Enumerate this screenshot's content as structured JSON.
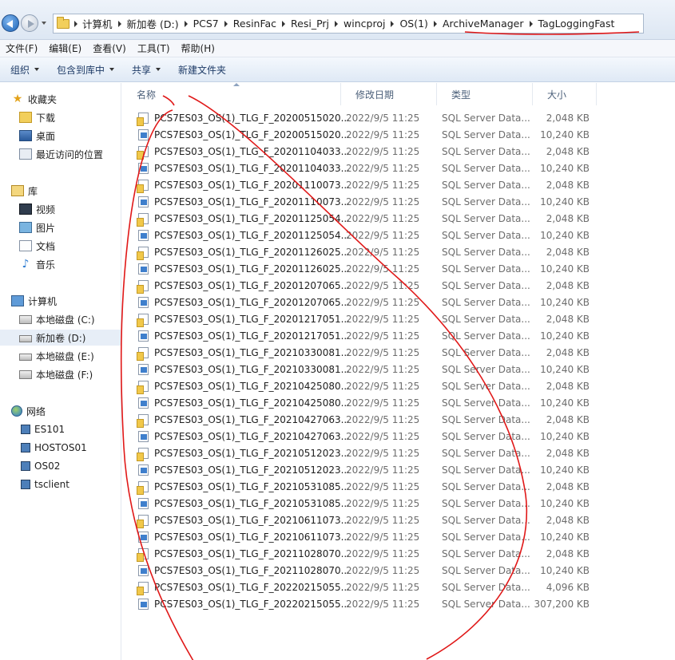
{
  "breadcrumb": [
    "计算机",
    "新加卷 (D:)",
    "PCS7",
    "ResinFac",
    "Resi_Prj",
    "wincproj",
    "OS(1)",
    "ArchiveManager",
    "TagLoggingFast"
  ],
  "menu": [
    "文件(F)",
    "编辑(E)",
    "查看(V)",
    "工具(T)",
    "帮助(H)"
  ],
  "toolbar": {
    "organize": "组织",
    "include_library": "包含到库中",
    "share": "共享",
    "new_folder": "新建文件夹"
  },
  "sidebar": {
    "favorites": {
      "label": "收藏夹",
      "items": [
        "下载",
        "桌面",
        "最近访问的位置"
      ]
    },
    "libraries": {
      "label": "库",
      "items": [
        "视频",
        "图片",
        "文档",
        "音乐"
      ]
    },
    "computer": {
      "label": "计算机",
      "items": [
        "本地磁盘 (C:)",
        "新加卷 (D:)",
        "本地磁盘 (E:)",
        "本地磁盘 (F:)"
      ]
    },
    "network": {
      "label": "网络",
      "items": [
        "ES101",
        "HOSTOS01",
        "OS02",
        "tsclient"
      ]
    }
  },
  "columns": {
    "name": "名称",
    "modified": "修改日期",
    "type": "类型",
    "size": "大小"
  },
  "files": [
    {
      "name": "PCS7ES03_OS(1)_TLG_F_20200515020...",
      "date": "2022/9/5 11:25",
      "type": "SQL Server Data...",
      "size": "2,048 KB",
      "icon": "ldf"
    },
    {
      "name": "PCS7ES03_OS(1)_TLG_F_20200515020...",
      "date": "2022/9/5 11:25",
      "type": "SQL Server Data...",
      "size": "10,240 KB",
      "icon": "mdf"
    },
    {
      "name": "PCS7ES03_OS(1)_TLG_F_20201104033...",
      "date": "2022/9/5 11:25",
      "type": "SQL Server Data...",
      "size": "2,048 KB",
      "icon": "ldf"
    },
    {
      "name": "PCS7ES03_OS(1)_TLG_F_20201104033...",
      "date": "2022/9/5 11:25",
      "type": "SQL Server Data...",
      "size": "10,240 KB",
      "icon": "mdf"
    },
    {
      "name": "PCS7ES03_OS(1)_TLG_F_20201110073...",
      "date": "2022/9/5 11:25",
      "type": "SQL Server Data...",
      "size": "2,048 KB",
      "icon": "ldf"
    },
    {
      "name": "PCS7ES03_OS(1)_TLG_F_20201110073...",
      "date": "2022/9/5 11:25",
      "type": "SQL Server Data...",
      "size": "10,240 KB",
      "icon": "mdf"
    },
    {
      "name": "PCS7ES03_OS(1)_TLG_F_20201125054...",
      "date": "2022/9/5 11:25",
      "type": "SQL Server Data...",
      "size": "2,048 KB",
      "icon": "ldf"
    },
    {
      "name": "PCS7ES03_OS(1)_TLG_F_20201125054...",
      "date": "2022/9/5 11:25",
      "type": "SQL Server Data...",
      "size": "10,240 KB",
      "icon": "mdf"
    },
    {
      "name": "PCS7ES03_OS(1)_TLG_F_20201126025...",
      "date": "2022/9/5 11:25",
      "type": "SQL Server Data...",
      "size": "2,048 KB",
      "icon": "ldf"
    },
    {
      "name": "PCS7ES03_OS(1)_TLG_F_20201126025...",
      "date": "2022/9/5 11:25",
      "type": "SQL Server Data...",
      "size": "10,240 KB",
      "icon": "mdf"
    },
    {
      "name": "PCS7ES03_OS(1)_TLG_F_20201207065...",
      "date": "2022/9/5 11:25",
      "type": "SQL Server Data...",
      "size": "2,048 KB",
      "icon": "ldf"
    },
    {
      "name": "PCS7ES03_OS(1)_TLG_F_20201207065...",
      "date": "2022/9/5 11:25",
      "type": "SQL Server Data...",
      "size": "10,240 KB",
      "icon": "mdf"
    },
    {
      "name": "PCS7ES03_OS(1)_TLG_F_20201217051...",
      "date": "2022/9/5 11:25",
      "type": "SQL Server Data...",
      "size": "2,048 KB",
      "icon": "ldf"
    },
    {
      "name": "PCS7ES03_OS(1)_TLG_F_20201217051...",
      "date": "2022/9/5 11:25",
      "type": "SQL Server Data...",
      "size": "10,240 KB",
      "icon": "mdf"
    },
    {
      "name": "PCS7ES03_OS(1)_TLG_F_20210330081...",
      "date": "2022/9/5 11:25",
      "type": "SQL Server Data...",
      "size": "2,048 KB",
      "icon": "ldf"
    },
    {
      "name": "PCS7ES03_OS(1)_TLG_F_20210330081...",
      "date": "2022/9/5 11:25",
      "type": "SQL Server Data...",
      "size": "10,240 KB",
      "icon": "mdf"
    },
    {
      "name": "PCS7ES03_OS(1)_TLG_F_20210425080...",
      "date": "2022/9/5 11:25",
      "type": "SQL Server Data...",
      "size": "2,048 KB",
      "icon": "ldf"
    },
    {
      "name": "PCS7ES03_OS(1)_TLG_F_20210425080...",
      "date": "2022/9/5 11:25",
      "type": "SQL Server Data...",
      "size": "10,240 KB",
      "icon": "mdf"
    },
    {
      "name": "PCS7ES03_OS(1)_TLG_F_20210427063...",
      "date": "2022/9/5 11:25",
      "type": "SQL Server Data...",
      "size": "2,048 KB",
      "icon": "ldf"
    },
    {
      "name": "PCS7ES03_OS(1)_TLG_F_20210427063...",
      "date": "2022/9/5 11:25",
      "type": "SQL Server Data...",
      "size": "10,240 KB",
      "icon": "mdf"
    },
    {
      "name": "PCS7ES03_OS(1)_TLG_F_20210512023...",
      "date": "2022/9/5 11:25",
      "type": "SQL Server Data...",
      "size": "2,048 KB",
      "icon": "ldf"
    },
    {
      "name": "PCS7ES03_OS(1)_TLG_F_20210512023...",
      "date": "2022/9/5 11:25",
      "type": "SQL Server Data...",
      "size": "10,240 KB",
      "icon": "mdf"
    },
    {
      "name": "PCS7ES03_OS(1)_TLG_F_20210531085...",
      "date": "2022/9/5 11:25",
      "type": "SQL Server Data...",
      "size": "2,048 KB",
      "icon": "ldf"
    },
    {
      "name": "PCS7ES03_OS(1)_TLG_F_20210531085...",
      "date": "2022/9/5 11:25",
      "type": "SQL Server Data...",
      "size": "10,240 KB",
      "icon": "mdf"
    },
    {
      "name": "PCS7ES03_OS(1)_TLG_F_20210611073...",
      "date": "2022/9/5 11:25",
      "type": "SQL Server Data...",
      "size": "2,048 KB",
      "icon": "ldf"
    },
    {
      "name": "PCS7ES03_OS(1)_TLG_F_20210611073...",
      "date": "2022/9/5 11:25",
      "type": "SQL Server Data...",
      "size": "10,240 KB",
      "icon": "mdf"
    },
    {
      "name": "PCS7ES03_OS(1)_TLG_F_20211028070...",
      "date": "2022/9/5 11:25",
      "type": "SQL Server Data...",
      "size": "2,048 KB",
      "icon": "ldf"
    },
    {
      "name": "PCS7ES03_OS(1)_TLG_F_20211028070...",
      "date": "2022/9/5 11:25",
      "type": "SQL Server Data...",
      "size": "10,240 KB",
      "icon": "mdf"
    },
    {
      "name": "PCS7ES03_OS(1)_TLG_F_20220215055...",
      "date": "2022/9/5 11:25",
      "type": "SQL Server Data...",
      "size": "4,096 KB",
      "icon": "ldf"
    },
    {
      "name": "PCS7ES03_OS(1)_TLG_F_20220215055...",
      "date": "2022/9/5 11:25",
      "type": "SQL Server Data...",
      "size": "307,200 KB",
      "icon": "mdf"
    }
  ],
  "annotation_color": "#e01818"
}
